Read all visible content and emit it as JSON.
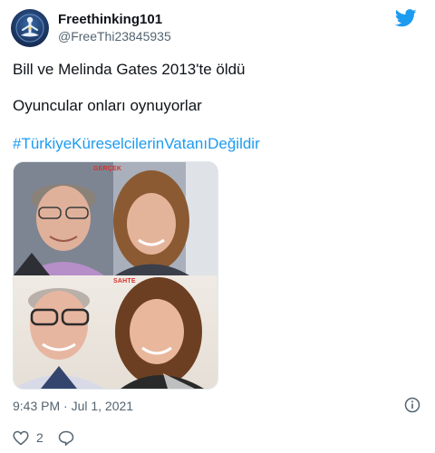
{
  "tweet": {
    "display_name": "Freethinking101",
    "handle": "@FreeThi23845935",
    "text_line1": "Bill ve Melinda Gates 2013'te öldü",
    "text_line2": "Oyuncular onları oynuyorlar",
    "hashtag": "#TürkiyeKüreselcilerinVatanıDeğildir",
    "timestamp": "9:43 PM · Jul 1, 2021",
    "likes": "2"
  },
  "media": {
    "top_label": "GERÇEK",
    "bottom_label": "SAHTE"
  },
  "icons": {
    "brand": "twitter-bird-icon",
    "info": "info-icon",
    "like": "heart-icon",
    "reply": "reply-bubble-icon"
  },
  "colors": {
    "accent": "#1d9bf0",
    "text": "#0f1419",
    "muted": "#536471",
    "label_red": "#d8312a"
  }
}
